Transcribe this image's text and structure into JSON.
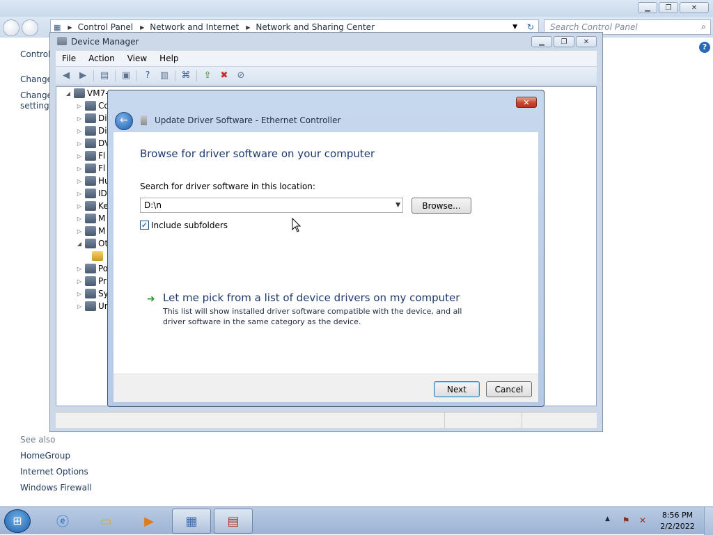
{
  "control_panel": {
    "address": {
      "crumbs": [
        "Control Panel",
        "Network and Internet",
        "Network and Sharing Center"
      ]
    },
    "search_placeholder": "Search Control Panel",
    "left_links": [
      "Control",
      "Change",
      "Change",
      "settings"
    ],
    "see_also_label": "See also",
    "see_also_links": [
      "HomeGroup",
      "Internet Options",
      "Windows Firewall"
    ]
  },
  "device_manager": {
    "title": "Device Manager",
    "menu": [
      "File",
      "Action",
      "View",
      "Help"
    ],
    "tree_root": "VM7-",
    "tree_items": [
      "Co",
      "Di",
      "Di",
      "DV",
      "Fl",
      "Fl",
      "Hu",
      "ID",
      "Ke",
      "M",
      "M",
      "Ot",
      "Po",
      "Pr",
      "Sy",
      "Ur"
    ]
  },
  "dialog": {
    "title": "Update Driver Software - Ethernet Controller",
    "heading": "Browse for driver software on your computer",
    "search_label": "Search for driver software in this location:",
    "path_value": "D:\\n",
    "browse_label": "Browse...",
    "include_subfolders_label": "Include subfolders",
    "include_subfolders_checked": true,
    "pick_title": "Let me pick from a list of device drivers on my computer",
    "pick_description": "This list will show installed driver software compatible with the device, and all driver software in the same category as the device.",
    "next_label": "Next",
    "cancel_label": "Cancel"
  },
  "taskbar": {
    "time": "8:56 PM",
    "date": "2/2/2022"
  }
}
